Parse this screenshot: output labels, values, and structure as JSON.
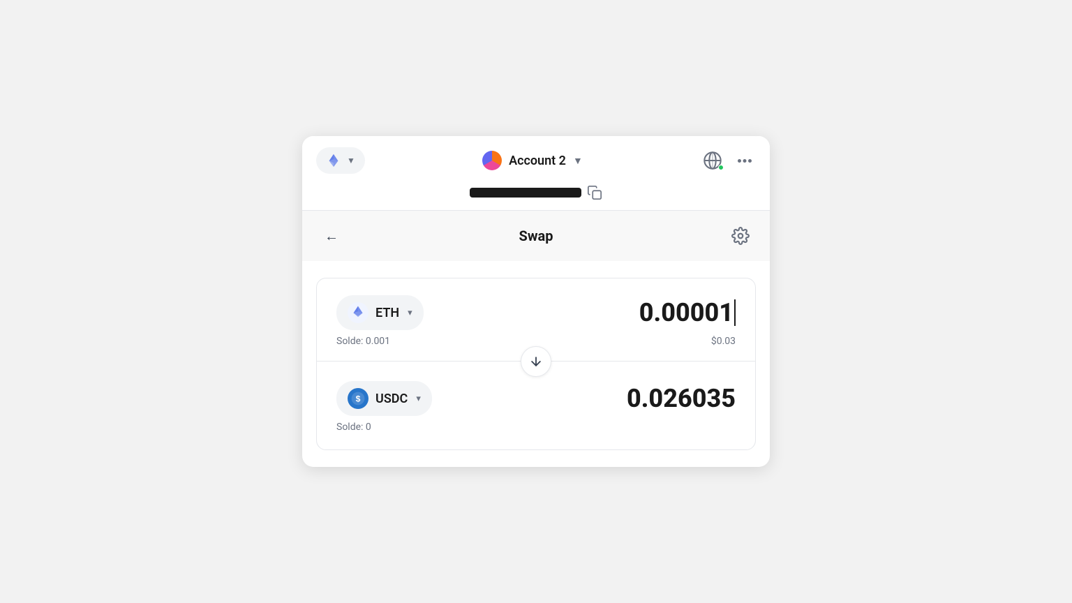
{
  "header": {
    "network_selector": {
      "label": "ETH",
      "chevron": "▼"
    },
    "account": {
      "name": "Account 2",
      "chevron": "▼"
    },
    "address": {
      "redacted": true
    },
    "copy_tooltip": "Copy address",
    "three_dots_label": "⋮"
  },
  "swap": {
    "title": "Swap",
    "back_label": "←",
    "settings_label": "⚙"
  },
  "from_token": {
    "symbol": "ETH",
    "amount": "0.00001",
    "balance_label": "Solde: 0.001",
    "usd_value": "$0.03"
  },
  "to_token": {
    "symbol": "USDC",
    "amount": "0.026035",
    "balance_label": "Solde: 0"
  }
}
